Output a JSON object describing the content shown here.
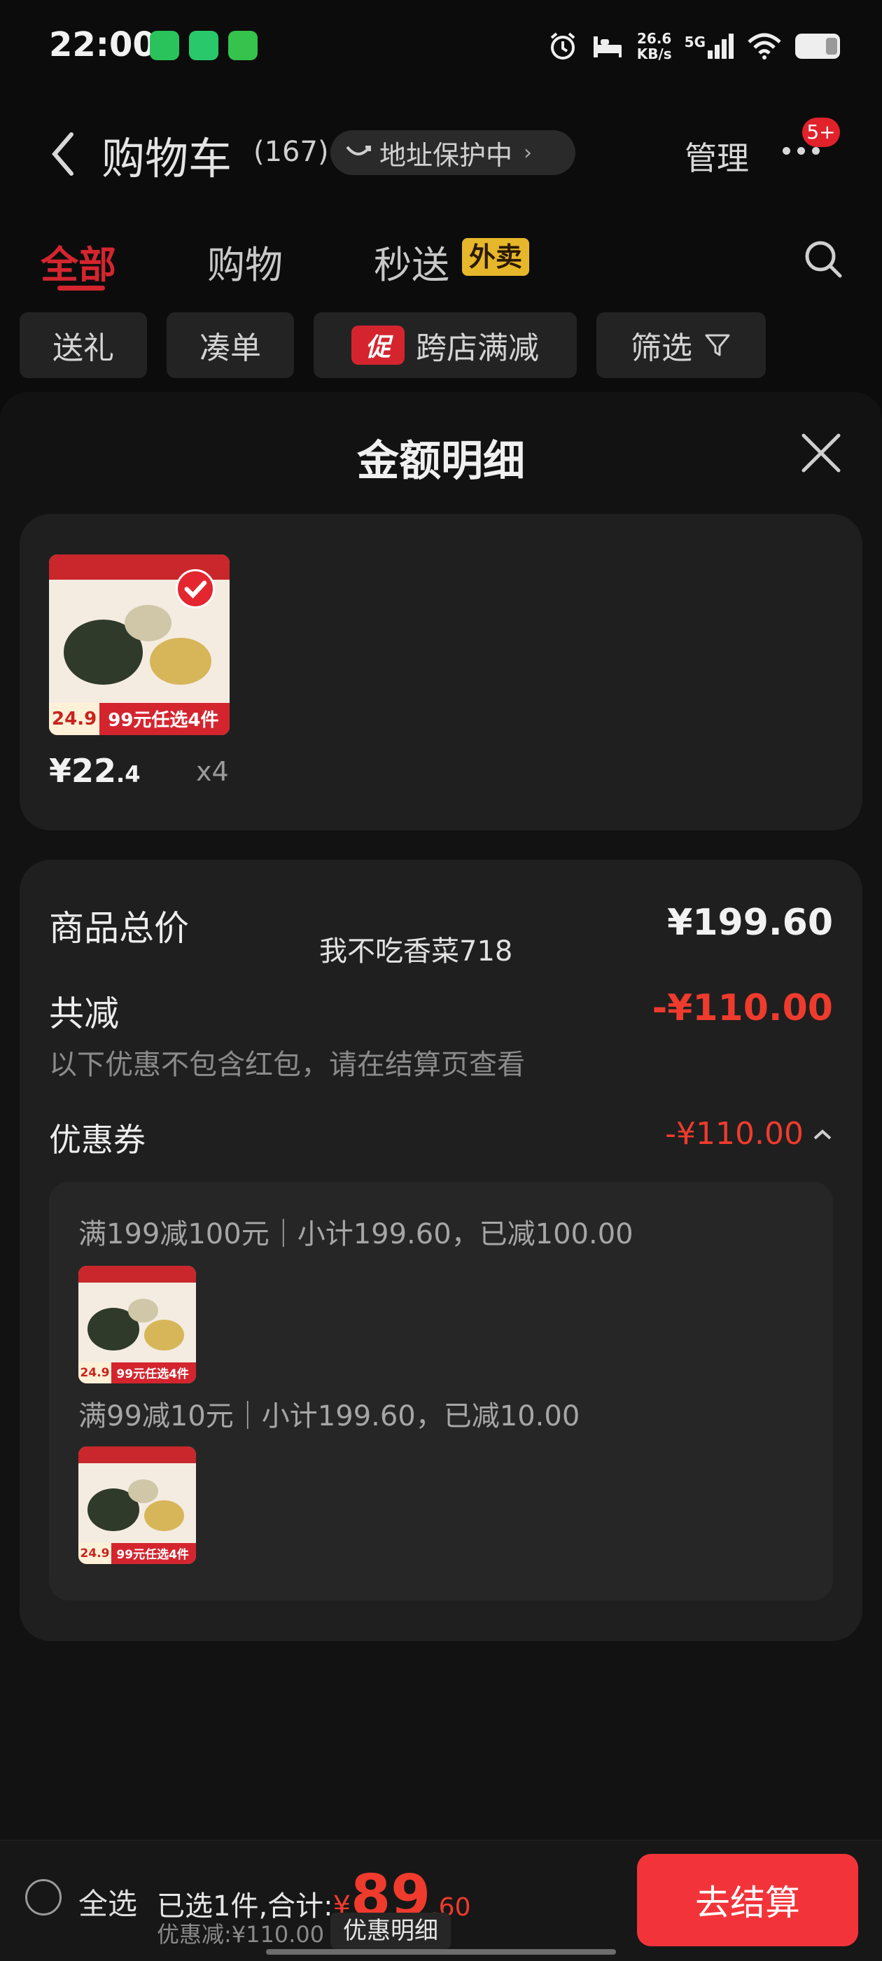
{
  "status_bar": {
    "time": "22:00",
    "net_speed_value": "26.6",
    "net_speed_unit": "KB/s",
    "network": "5G",
    "icons": [
      "wechat-icon",
      "app-icon",
      "chat-icon",
      "alarm-icon",
      "sleep-icon",
      "signal-icon",
      "wifi-icon",
      "battery-icon"
    ]
  },
  "header": {
    "title": "购物车",
    "count": "(167)",
    "address_protect": "地址保护中",
    "manage": "管理",
    "badge": "5+"
  },
  "tabs": [
    {
      "label": "全部",
      "active": true
    },
    {
      "label": "购物",
      "active": false
    },
    {
      "label": "秒送",
      "active": false,
      "tag": "外卖"
    }
  ],
  "filters": {
    "gift": "送礼",
    "bundle": "凑单",
    "promo_tag": "促",
    "cross_store": "跨店满减",
    "filter": "筛选"
  },
  "sheet": {
    "title": "金额明细",
    "product": {
      "price_main": "¥22",
      "price_dec": ".4",
      "qty": "x4",
      "thumb_price": "24.9",
      "thumb_banner": "99元任选4件"
    },
    "summary": {
      "total_label": "商品总价",
      "total_value": "¥199.60",
      "watermark": "我不吃香菜718",
      "discount_label": "共减",
      "discount_value": "-¥110.00",
      "discount_hint": "以下优惠不包含红包，请在结算页查看",
      "coupon_label": "优惠券",
      "coupon_value": "-¥110.00",
      "coupon_rules": [
        "满199减100元｜小计199.60，已减100.00",
        "满99减10元｜小计199.60，已减10.00"
      ]
    }
  },
  "bottom_bar": {
    "select_all": "全选",
    "selected_text": "已选1件,合计:",
    "currency": "¥",
    "total_int": "89",
    "total_dec": ".60",
    "discount_text": "优惠减:¥110.00",
    "detail_link": "优惠明细",
    "checkout": "去结算"
  },
  "colors": {
    "accent_red": "#ef3b2d",
    "tab_red": "#d4252f",
    "checkout_red": "#f2343a",
    "waimai_yellow": "#e6b72a"
  }
}
